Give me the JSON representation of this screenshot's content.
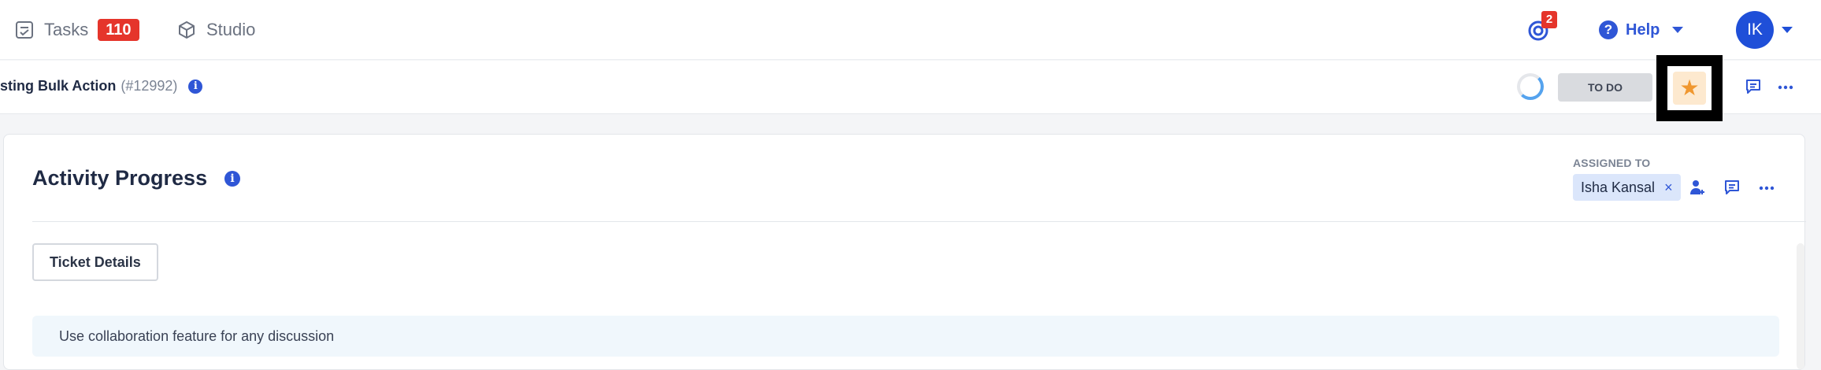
{
  "topbar": {
    "tasks": {
      "label": "Tasks",
      "count": "110"
    },
    "studio": {
      "label": "Studio"
    },
    "notifications": {
      "count": "2"
    },
    "help": {
      "label": "Help"
    },
    "user": {
      "initials": "IK"
    }
  },
  "task_header": {
    "title": "sting Bulk Action",
    "id": "(#12992)",
    "status": "TO DO",
    "starred": true
  },
  "card": {
    "title": "Activity Progress",
    "assigned_label": "ASSIGNED TO",
    "assignee": "Isha Kansal",
    "remove_symbol": "×",
    "ticket_details_label": "Ticket Details",
    "notice": "Use collaboration feature for any discussion"
  },
  "colors": {
    "accent": "#2f56d6",
    "badge": "#e5352b",
    "star": "#f0972f",
    "avatar": "#1f4fd8"
  }
}
